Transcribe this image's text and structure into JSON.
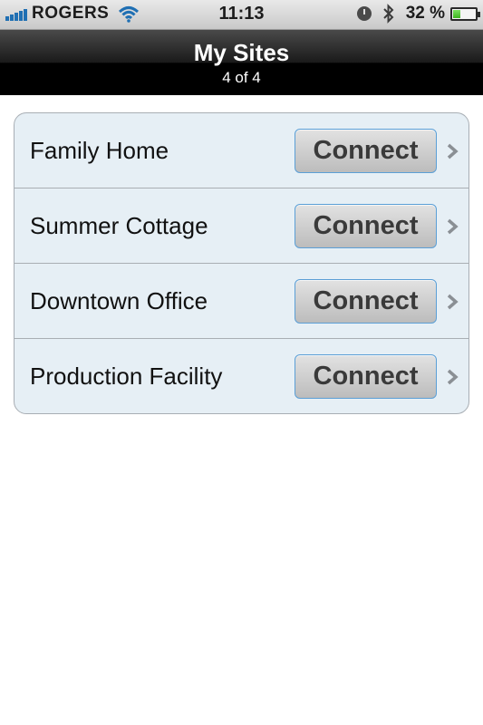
{
  "status_bar": {
    "carrier": "ROGERS",
    "time": "11:13",
    "battery_percent": "32 %",
    "battery_level": 0.32,
    "icons": [
      "signal-icon",
      "wifi-icon",
      "alarm-icon",
      "bluetooth-icon",
      "battery-icon"
    ]
  },
  "nav": {
    "title": "My Sites",
    "subtitle": "4 of 4"
  },
  "sites": [
    {
      "name": "Family Home",
      "button": "Connect"
    },
    {
      "name": "Summer Cottage",
      "button": "Connect"
    },
    {
      "name": "Downtown Office",
      "button": "Connect"
    },
    {
      "name": "Production Facility",
      "button": "Connect"
    }
  ],
  "colors": {
    "nav_background": "#000000",
    "row_background": "#e6eff5",
    "button_border": "#5b9fd6",
    "signal": "#1f6fb3",
    "battery_fill": "#3cb51f"
  }
}
